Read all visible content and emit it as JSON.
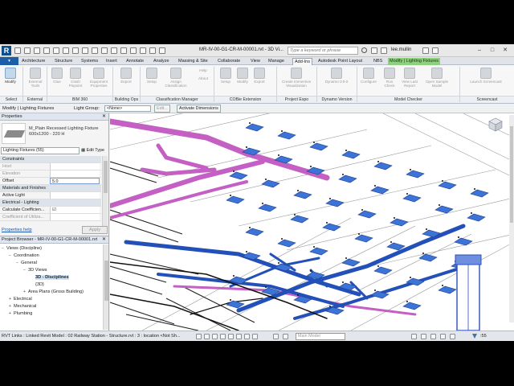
{
  "app": {
    "logo": "R",
    "document_title": "MR-IV-00-G1-CR-M-00001.rvt - 3D Vi...",
    "search_placeholder": "Type a keyword or phrase",
    "user_name": "lee.mullin"
  },
  "tabs": [
    {
      "label": "Architecture",
      "state": "normal"
    },
    {
      "label": "Structure",
      "state": "normal"
    },
    {
      "label": "Systems",
      "state": "normal"
    },
    {
      "label": "Insert",
      "state": "normal"
    },
    {
      "label": "Annotate",
      "state": "normal"
    },
    {
      "label": "Analyze",
      "state": "normal"
    },
    {
      "label": "Massing & Site",
      "state": "normal"
    },
    {
      "label": "Collaborate",
      "state": "normal"
    },
    {
      "label": "View",
      "state": "normal"
    },
    {
      "label": "Manage",
      "state": "normal"
    },
    {
      "label": "Add-Ins",
      "state": "active"
    },
    {
      "label": "Autodesk Point Layout",
      "state": "normal"
    },
    {
      "label": "NBS",
      "state": "normal"
    },
    {
      "label": "Modify | Lighting Fixtures",
      "state": "context"
    }
  ],
  "ribbon": {
    "tools": [
      {
        "label": "Modify",
        "icon": "cursor-icon",
        "enabled": true
      },
      {
        "label": "External Tools",
        "icon": "gear-icon",
        "enabled": false
      },
      {
        "label": "Glue",
        "icon": "glue-icon",
        "enabled": false
      },
      {
        "label": "Clash Pinpoint",
        "icon": "pin-icon",
        "enabled": false
      },
      {
        "label": "Equipment Properties",
        "icon": "equipment-icon",
        "enabled": false
      },
      {
        "label": "Export",
        "icon": "export-icon",
        "enabled": false
      },
      {
        "label": "Setup",
        "icon": "setup-icon",
        "enabled": false
      },
      {
        "label": "Assign Classification",
        "icon": "tag-icon",
        "enabled": false
      },
      {
        "label": "Help",
        "icon": "help-icon",
        "enabled": false
      },
      {
        "label": "About",
        "icon": "info-icon",
        "enabled": false
      },
      {
        "label": "Setup",
        "icon": "setup-icon",
        "enabled": false
      },
      {
        "label": "Modify",
        "icon": "modify-icon",
        "enabled": false
      },
      {
        "label": "Export",
        "icon": "export-icon",
        "enabled": false
      },
      {
        "label": "Create Immersive Visualization",
        "icon": "vr-icon",
        "enabled": false
      },
      {
        "label": "Dynamo 0.9.0",
        "icon": "dynamo-icon",
        "enabled": false
      },
      {
        "label": "Configure",
        "icon": "configure-icon",
        "enabled": false
      },
      {
        "label": "Run Check",
        "icon": "run-icon",
        "enabled": false
      },
      {
        "label": "View Last Report",
        "icon": "report-icon",
        "enabled": false
      },
      {
        "label": "Open Sample Model",
        "icon": "open-icon",
        "enabled": false
      },
      {
        "label": "Launch Screencast",
        "icon": "screencast-icon",
        "enabled": false
      }
    ],
    "panels": [
      {
        "label": "Select"
      },
      {
        "label": "External"
      },
      {
        "label": "BIM 360"
      },
      {
        "label": "Building Ops"
      },
      {
        "label": "Classification Manager"
      },
      {
        "label": "COBie Extension"
      },
      {
        "label": "Project Expo"
      },
      {
        "label": "Dynamo Version"
      },
      {
        "label": "Model Checker"
      },
      {
        "label": "Screencast"
      }
    ]
  },
  "options_bar": {
    "context_label": "Modify | Lighting Fixtures",
    "light_group_label": "Light Group:",
    "light_group_value": "<None>",
    "edit_label": "Edit...",
    "activate_dimensions": "Activate Dimensions"
  },
  "properties": {
    "title": "Properties",
    "type_name": "M_Plain Recessed Lighting Fixture 600x1200 - 220 H",
    "type_filter": "Lighting Fixtures (55)",
    "edit_type": "Edit Type",
    "rows": [
      {
        "name": "Constraints",
        "value": "",
        "kind": "group"
      },
      {
        "name": "Host",
        "value": "",
        "kind": "grey"
      },
      {
        "name": "Elevation",
        "value": "",
        "kind": "grey"
      },
      {
        "name": "Offset",
        "value": "5.0",
        "kind": "normal"
      },
      {
        "name": "Materials and Finishes",
        "value": "",
        "kind": "group"
      },
      {
        "name": "Active Light",
        "value": "",
        "kind": "normal"
      },
      {
        "name": "Electrical - Lighting",
        "value": "",
        "kind": "group"
      },
      {
        "name": "Calculate Coefficien...",
        "value": "☑",
        "kind": "normal"
      },
      {
        "name": "Coefficient of Utiliza...",
        "value": "",
        "kind": "grey"
      }
    ],
    "help_link": "Properties help",
    "apply_label": "Apply"
  },
  "project_browser": {
    "title": "Project Browser - MR-IV-00-G1-CR-M-00001.rvt",
    "nodes": [
      {
        "label": "Views (Discipline)",
        "toggle": "−",
        "depth": 0,
        "selected": false
      },
      {
        "label": "Coordination",
        "toggle": "−",
        "depth": 1,
        "selected": false
      },
      {
        "label": "General",
        "toggle": "−",
        "depth": 2,
        "selected": false
      },
      {
        "label": "3D Views",
        "toggle": "−",
        "depth": 3,
        "selected": false
      },
      {
        "label": "3D - Disciplines",
        "toggle": "",
        "depth": 4,
        "selected": true
      },
      {
        "label": "{3D}",
        "toggle": "",
        "depth": 4,
        "selected": false
      },
      {
        "label": "Area Plans (Gross Building)",
        "toggle": "+",
        "depth": 3,
        "selected": false
      },
      {
        "label": "Electrical",
        "toggle": "+",
        "depth": 1,
        "selected": false
      },
      {
        "label": "Mechanical",
        "toggle": "+",
        "depth": 1,
        "selected": false
      },
      {
        "label": "Plumbing",
        "toggle": "+",
        "depth": 1,
        "selected": false
      }
    ]
  },
  "status": {
    "text": "RVT Links : Linked Revit Model : 02 Railway Station - Structure.rvt : 3 : location <Not Sh...",
    "model_box": "Main Model",
    "selection_count": ":55"
  },
  "colors": {
    "duct": "#2350b8",
    "pipe_highlight": "#c45fc4",
    "fixture": "#3b73d6",
    "context_tab": "#8ed07f",
    "selection": "#cfe2f6"
  }
}
